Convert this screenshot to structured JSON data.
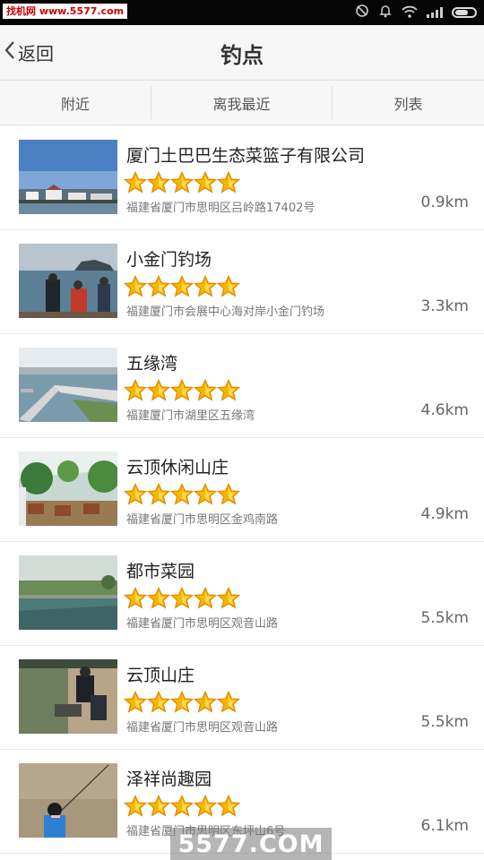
{
  "watermark_top": "找机网 www.5577.com",
  "watermark_bottom": "5577.COM",
  "header": {
    "back_label": "返回",
    "title": "钓点"
  },
  "tabs": [
    "附近",
    "离我最近",
    "列表"
  ],
  "items": [
    {
      "name": "厦门土巴巴生态菜篮子有限公司",
      "address": "福建省厦门市思明区吕岭路17402号",
      "distance": "0.9km",
      "rating": 5
    },
    {
      "name": "小金门钓场",
      "address": "福建厦门市会展中心海对岸小金门钓场",
      "distance": "3.3km",
      "rating": 5
    },
    {
      "name": "五缘湾",
      "address": "福建厦门市湖里区五缘湾",
      "distance": "4.6km",
      "rating": 5
    },
    {
      "name": "云顶休闲山庄",
      "address": "福建省厦门市思明区金鸡南路",
      "distance": "4.9km",
      "rating": 5
    },
    {
      "name": "都市菜园",
      "address": "福建省厦门市思明区观音山路",
      "distance": "5.5km",
      "rating": 5
    },
    {
      "name": "云顶山庄",
      "address": "福建省厦门市思明区观音山路",
      "distance": "5.5km",
      "rating": 5
    },
    {
      "name": "泽祥尚趣园",
      "address": "福建省厦门市思明区东坪山6号",
      "distance": "6.1km",
      "rating": 5
    }
  ]
}
